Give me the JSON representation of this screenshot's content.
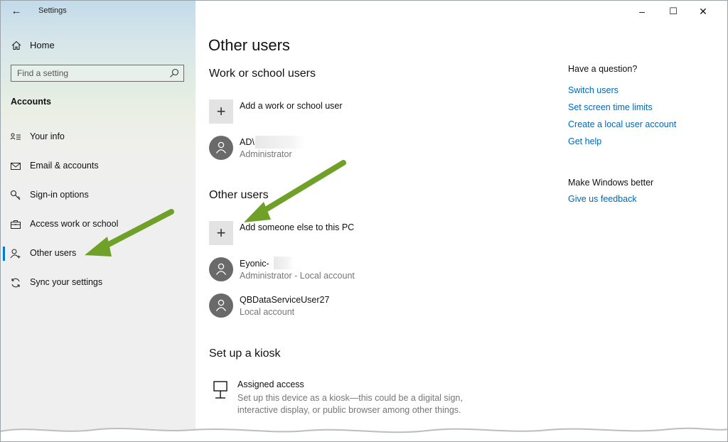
{
  "window": {
    "title": "Settings",
    "controls": {
      "minimize": "–",
      "maximize": "☐",
      "close": "✕"
    }
  },
  "sidebar": {
    "back_glyph": "←",
    "home": {
      "label": "Home",
      "icon": "home-icon"
    },
    "search": {
      "placeholder": "Find a setting",
      "value": ""
    },
    "section": "Accounts",
    "items": [
      {
        "label": "Your info",
        "icon": "person-card-icon",
        "active": false
      },
      {
        "label": "Email & accounts",
        "icon": "envelope-icon",
        "active": false
      },
      {
        "label": "Sign-in options",
        "icon": "key-icon",
        "active": false
      },
      {
        "label": "Access work or school",
        "icon": "briefcase-icon",
        "active": false
      },
      {
        "label": "Other users",
        "icon": "person-add-icon",
        "active": true
      },
      {
        "label": "Sync your settings",
        "icon": "sync-icon",
        "active": false
      }
    ]
  },
  "main": {
    "title": "Other users",
    "work_section": {
      "heading": "Work or school users",
      "add_label": "Add a work or school user",
      "users": [
        {
          "name": "AD\\",
          "role": "Administrator"
        }
      ]
    },
    "other_section": {
      "heading": "Other users",
      "add_label": "Add someone else to this PC",
      "users": [
        {
          "name": "Eyonic-",
          "role": "Administrator - Local account"
        },
        {
          "name": "QBDataServiceUser27",
          "role": "Local account"
        }
      ]
    },
    "kiosk_section": {
      "heading": "Set up a kiosk",
      "item_title": "Assigned access",
      "item_desc": "Set up this device as a kiosk—this could be a digital sign, interactive display, or public browser among other things."
    }
  },
  "right_panel": {
    "question_heading": "Have a question?",
    "links": [
      "Switch users",
      "Set screen time limits",
      "Create a local user account",
      "Get help"
    ],
    "better_heading": "Make Windows better",
    "feedback_link": "Give us feedback"
  },
  "colors": {
    "accent": "#0078d7",
    "link": "#0067b8",
    "arrow": "#6fa028",
    "avatar": "#6a6a6a"
  }
}
